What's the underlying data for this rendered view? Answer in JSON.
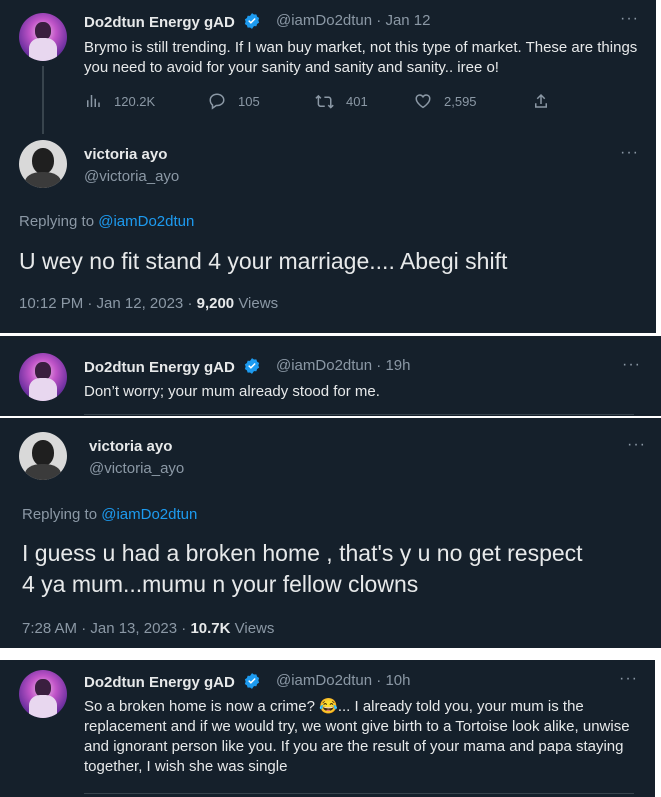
{
  "tweet1": {
    "name": "Do2dtun Energy gAD",
    "handle": "@iamDo2dtun",
    "time": "· Jan 12",
    "text": "Brymo is still trending. If I wan buy market, not this type of market. These are things you need to avoid for your sanity and sanity and sanity.. iree o!",
    "views": "120.2K",
    "replies": "105",
    "retweets": "401",
    "likes": "2,595"
  },
  "tweet2": {
    "name": "victoria ayo",
    "handle": "@victoria_ayo",
    "replying_prefix": "Replying to ",
    "replying_to": "@iamDo2dtun",
    "text": "U wey no fit stand 4 your marriage.... Abegi shift",
    "timestamp": "10:12 PM · Jan 12, 2023 · ",
    "view_count": "9,200",
    "views_label": " Views"
  },
  "tweet3": {
    "name": "Do2dtun Energy gAD",
    "handle": "@iamDo2dtun",
    "time": "· 19h",
    "text": "Don’t worry; your mum already stood for me."
  },
  "tweet4": {
    "name": "victoria ayo",
    "handle": "@victoria_ayo",
    "replying_prefix": "Replying to ",
    "replying_to": "@iamDo2dtun",
    "text_line1": "I guess u had a broken home , that's y u no get respect",
    "text_line2": "4 ya mum...mumu n your fellow clowns",
    "timestamp": "7:28 AM · Jan 13, 2023 · ",
    "view_count": "10.7K",
    "views_label": " Views"
  },
  "tweet5": {
    "name": "Do2dtun Energy gAD",
    "handle": "@iamDo2dtun",
    "time": "· 10h",
    "text_before_emoji": "So a broken home is now a crime? ",
    "emoji": "😂",
    "text_after_emoji": "... I already told you, your mum is the replacement and if we would try, we wont give birth to a Tortoise look alike, unwise and ignorant person like you. If you are the result of your mama and papa staying together, I wish she was single"
  },
  "icons": {
    "more": "more-icon",
    "verified": "verified-badge-icon",
    "views": "analytics-icon",
    "reply": "reply-icon",
    "retweet": "retweet-icon",
    "like": "heart-icon",
    "share": "share-icon"
  },
  "colors": {
    "background": "#15202b",
    "link": "#1d9bf0",
    "secondary_text": "#8b98a5",
    "primary_text": "#e7e9ea"
  }
}
